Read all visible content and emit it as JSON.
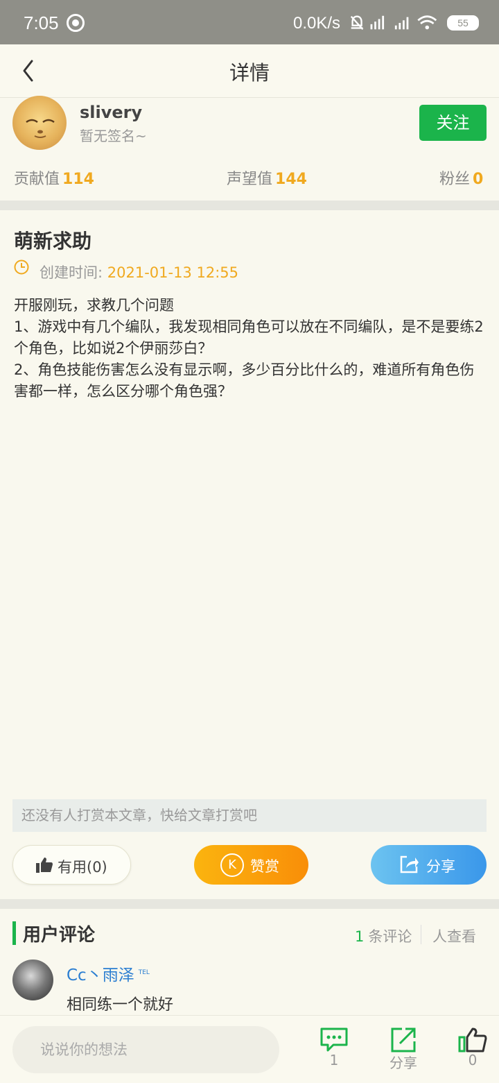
{
  "status_bar": {
    "time": "7:05",
    "network_speed": "0.0K/s",
    "battery": "55"
  },
  "header": {
    "title": "详情",
    "back_icon": "chevron-left-icon"
  },
  "author": {
    "username": "slivery",
    "signature": "暂无签名~",
    "follow_label": "关注",
    "stats": [
      {
        "label": "贡献值",
        "value": "114"
      },
      {
        "label": "声望值",
        "value": "144"
      },
      {
        "label": "粉丝",
        "value": "0"
      }
    ]
  },
  "post": {
    "title": "萌新求助",
    "created_label": "创建时间:",
    "created_value": "2021-01-13 12:55",
    "body": [
      "开服刚玩，求教几个问题",
      "1、游戏中有几个编队，我发现相同角色可以放在不同编队，是不是要练2个角色，比如说2个伊丽莎白？",
      "2、角色技能伤害怎么没有显示啊，多少百分比什么的，难道所有角色伤害都一样，怎么区分哪个角色强？"
    ]
  },
  "reward": {
    "notice": "还没有人打赏本文章，快给文章打赏吧",
    "useful_label": "有用(0)",
    "reward_label": "赞赏",
    "reward_icon_letter": "K",
    "share_label": "分享"
  },
  "comments": {
    "title": "用户评论",
    "count": "1",
    "count_suffix": "条评论",
    "views_label": "人查看",
    "items": [
      {
        "name": "Cc丶雨泽",
        "badge": "TEL",
        "text": "相同练一个就好"
      }
    ]
  },
  "bottom_bar": {
    "input_placeholder": "说说你的想法",
    "comment_count": "1",
    "share_label": "分享",
    "like_count": "0"
  },
  "colors": {
    "accent_green": "#1bb44b",
    "accent_orange": "#f0a91f",
    "link_blue": "#2b7ed1",
    "background": "#f9f8ee"
  }
}
